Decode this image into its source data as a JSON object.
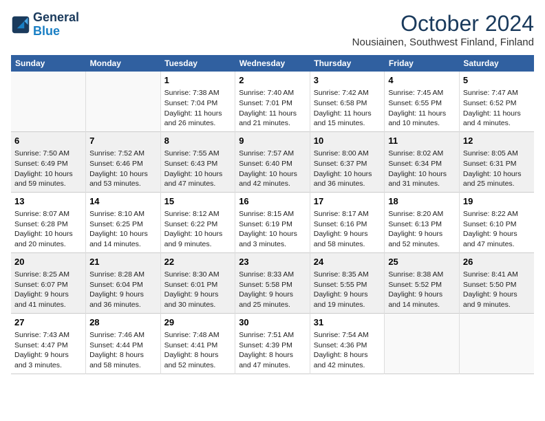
{
  "header": {
    "logo_line1": "General",
    "logo_line2": "Blue",
    "month": "October 2024",
    "location": "Nousiainen, Southwest Finland, Finland"
  },
  "days_of_week": [
    "Sunday",
    "Monday",
    "Tuesday",
    "Wednesday",
    "Thursday",
    "Friday",
    "Saturday"
  ],
  "weeks": [
    [
      {
        "day": "",
        "info": ""
      },
      {
        "day": "",
        "info": ""
      },
      {
        "day": "1",
        "info": "Sunrise: 7:38 AM\nSunset: 7:04 PM\nDaylight: 11 hours\nand 26 minutes."
      },
      {
        "day": "2",
        "info": "Sunrise: 7:40 AM\nSunset: 7:01 PM\nDaylight: 11 hours\nand 21 minutes."
      },
      {
        "day": "3",
        "info": "Sunrise: 7:42 AM\nSunset: 6:58 PM\nDaylight: 11 hours\nand 15 minutes."
      },
      {
        "day": "4",
        "info": "Sunrise: 7:45 AM\nSunset: 6:55 PM\nDaylight: 11 hours\nand 10 minutes."
      },
      {
        "day": "5",
        "info": "Sunrise: 7:47 AM\nSunset: 6:52 PM\nDaylight: 11 hours\nand 4 minutes."
      }
    ],
    [
      {
        "day": "6",
        "info": "Sunrise: 7:50 AM\nSunset: 6:49 PM\nDaylight: 10 hours\nand 59 minutes."
      },
      {
        "day": "7",
        "info": "Sunrise: 7:52 AM\nSunset: 6:46 PM\nDaylight: 10 hours\nand 53 minutes."
      },
      {
        "day": "8",
        "info": "Sunrise: 7:55 AM\nSunset: 6:43 PM\nDaylight: 10 hours\nand 47 minutes."
      },
      {
        "day": "9",
        "info": "Sunrise: 7:57 AM\nSunset: 6:40 PM\nDaylight: 10 hours\nand 42 minutes."
      },
      {
        "day": "10",
        "info": "Sunrise: 8:00 AM\nSunset: 6:37 PM\nDaylight: 10 hours\nand 36 minutes."
      },
      {
        "day": "11",
        "info": "Sunrise: 8:02 AM\nSunset: 6:34 PM\nDaylight: 10 hours\nand 31 minutes."
      },
      {
        "day": "12",
        "info": "Sunrise: 8:05 AM\nSunset: 6:31 PM\nDaylight: 10 hours\nand 25 minutes."
      }
    ],
    [
      {
        "day": "13",
        "info": "Sunrise: 8:07 AM\nSunset: 6:28 PM\nDaylight: 10 hours\nand 20 minutes."
      },
      {
        "day": "14",
        "info": "Sunrise: 8:10 AM\nSunset: 6:25 PM\nDaylight: 10 hours\nand 14 minutes."
      },
      {
        "day": "15",
        "info": "Sunrise: 8:12 AM\nSunset: 6:22 PM\nDaylight: 10 hours\nand 9 minutes."
      },
      {
        "day": "16",
        "info": "Sunrise: 8:15 AM\nSunset: 6:19 PM\nDaylight: 10 hours\nand 3 minutes."
      },
      {
        "day": "17",
        "info": "Sunrise: 8:17 AM\nSunset: 6:16 PM\nDaylight: 9 hours\nand 58 minutes."
      },
      {
        "day": "18",
        "info": "Sunrise: 8:20 AM\nSunset: 6:13 PM\nDaylight: 9 hours\nand 52 minutes."
      },
      {
        "day": "19",
        "info": "Sunrise: 8:22 AM\nSunset: 6:10 PM\nDaylight: 9 hours\nand 47 minutes."
      }
    ],
    [
      {
        "day": "20",
        "info": "Sunrise: 8:25 AM\nSunset: 6:07 PM\nDaylight: 9 hours\nand 41 minutes."
      },
      {
        "day": "21",
        "info": "Sunrise: 8:28 AM\nSunset: 6:04 PM\nDaylight: 9 hours\nand 36 minutes."
      },
      {
        "day": "22",
        "info": "Sunrise: 8:30 AM\nSunset: 6:01 PM\nDaylight: 9 hours\nand 30 minutes."
      },
      {
        "day": "23",
        "info": "Sunrise: 8:33 AM\nSunset: 5:58 PM\nDaylight: 9 hours\nand 25 minutes."
      },
      {
        "day": "24",
        "info": "Sunrise: 8:35 AM\nSunset: 5:55 PM\nDaylight: 9 hours\nand 19 minutes."
      },
      {
        "day": "25",
        "info": "Sunrise: 8:38 AM\nSunset: 5:52 PM\nDaylight: 9 hours\nand 14 minutes."
      },
      {
        "day": "26",
        "info": "Sunrise: 8:41 AM\nSunset: 5:50 PM\nDaylight: 9 hours\nand 9 minutes."
      }
    ],
    [
      {
        "day": "27",
        "info": "Sunrise: 7:43 AM\nSunset: 4:47 PM\nDaylight: 9 hours\nand 3 minutes."
      },
      {
        "day": "28",
        "info": "Sunrise: 7:46 AM\nSunset: 4:44 PM\nDaylight: 8 hours\nand 58 minutes."
      },
      {
        "day": "29",
        "info": "Sunrise: 7:48 AM\nSunset: 4:41 PM\nDaylight: 8 hours\nand 52 minutes."
      },
      {
        "day": "30",
        "info": "Sunrise: 7:51 AM\nSunset: 4:39 PM\nDaylight: 8 hours\nand 47 minutes."
      },
      {
        "day": "31",
        "info": "Sunrise: 7:54 AM\nSunset: 4:36 PM\nDaylight: 8 hours\nand 42 minutes."
      },
      {
        "day": "",
        "info": ""
      },
      {
        "day": "",
        "info": ""
      }
    ]
  ]
}
